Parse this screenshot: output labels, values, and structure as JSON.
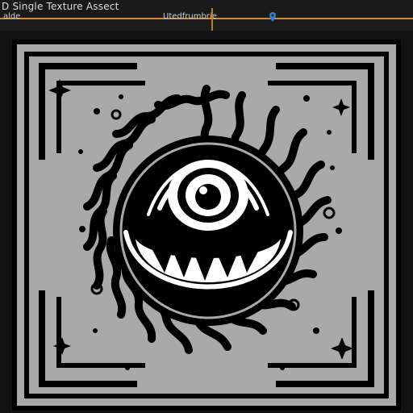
{
  "window": {
    "title": "D Single Texture Assect"
  },
  "toolbar": {
    "left_label": "alde",
    "center_label": "Utedfrumbrie"
  },
  "icons": {
    "pin": "location-pin-icon",
    "eye": "eye-icon"
  },
  "colors": {
    "accent_orange": "#d38b2c",
    "accent_blue": "#2f7fe0",
    "texture_bg": "#a9a9a9",
    "ink": "#000000"
  }
}
